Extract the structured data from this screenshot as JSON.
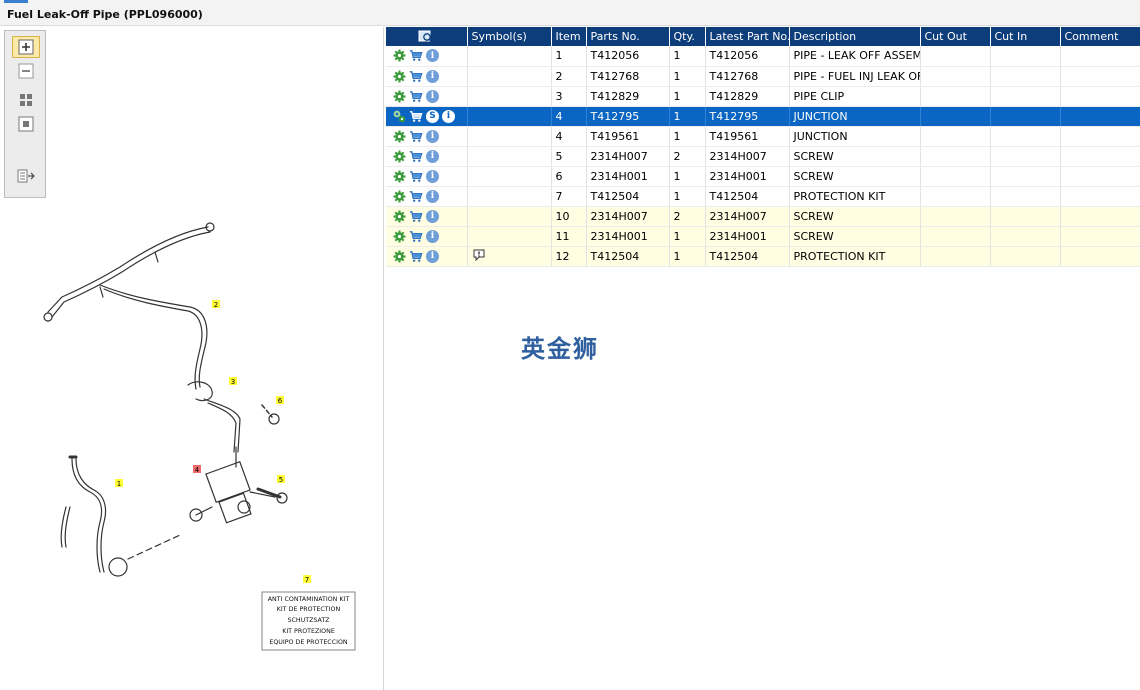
{
  "window": {
    "title": "Fuel Leak-Off Pipe (PPL096000)"
  },
  "table": {
    "columns": [
      "",
      "Symbol(s)",
      "Item",
      "Parts No.",
      "Qty.",
      "Latest Part No.",
      "Description",
      "Cut Out",
      "Cut In",
      "Comment"
    ],
    "rows": [
      {
        "item": "1",
        "part": "T412056",
        "qty": "1",
        "latest": "T412056",
        "desc": "PIPE - LEAK OFF ASSEMBLY"
      },
      {
        "item": "2",
        "part": "T412768",
        "qty": "1",
        "latest": "T412768",
        "desc": "PIPE - FUEL INJ LEAK OFF"
      },
      {
        "item": "3",
        "part": "T412829",
        "qty": "1",
        "latest": "T412829",
        "desc": "PIPE CLIP"
      },
      {
        "item": "4",
        "part": "T412795",
        "qty": "1",
        "latest": "T412795",
        "desc": "JUNCTION"
      },
      {
        "item": "4",
        "part": "T419561",
        "qty": "1",
        "latest": "T419561",
        "desc": "JUNCTION"
      },
      {
        "item": "5",
        "part": "2314H007",
        "qty": "2",
        "latest": "2314H007",
        "desc": "SCREW"
      },
      {
        "item": "6",
        "part": "2314H001",
        "qty": "1",
        "latest": "2314H001",
        "desc": "SCREW"
      },
      {
        "item": "7",
        "part": "T412504",
        "qty": "1",
        "latest": "T412504",
        "desc": "PROTECTION KIT"
      },
      {
        "item": "10",
        "part": "2314H007",
        "qty": "2",
        "latest": "2314H007",
        "desc": "SCREW"
      },
      {
        "item": "11",
        "part": "2314H001",
        "qty": "1",
        "latest": "2314H001",
        "desc": "SCREW"
      },
      {
        "item": "12",
        "part": "T412504",
        "qty": "1",
        "latest": "T412504",
        "desc": "PROTECTION KIT"
      }
    ]
  },
  "diagram": {
    "callouts": [
      "1",
      "2",
      "3",
      "4",
      "5",
      "6",
      "7"
    ],
    "kit_label_lines": [
      "ANTI CONTAMINATION KIT",
      "KIT DE PROTECTION",
      "SCHUTZSATZ",
      "KIT PROTEZIONE",
      "EQUIPO DE PROTECCION"
    ]
  },
  "watermark": {
    "text": "英金狮"
  },
  "icons": {
    "settings": "gear-icon",
    "cart": "cart-icon",
    "info": "info-icon",
    "info_letter": "i",
    "supersession": "s-badge-icon",
    "supersession_letter": "S",
    "note": "note-icon",
    "search": "search-icon",
    "zoom_in": "zoom-in-icon",
    "zoom_out": "zoom-out-icon",
    "fit": "fit-view-icon",
    "actual_size": "actual-size-icon",
    "export": "export-icon"
  },
  "colors": {
    "header_bg": "#0d3d7a",
    "selected_row": "#0a66c2",
    "highlight_row": "#fffee2",
    "gear_green": "#3a9b3a",
    "callout_yellow": "#ffff33",
    "callout_red": "#ef6a6a"
  }
}
